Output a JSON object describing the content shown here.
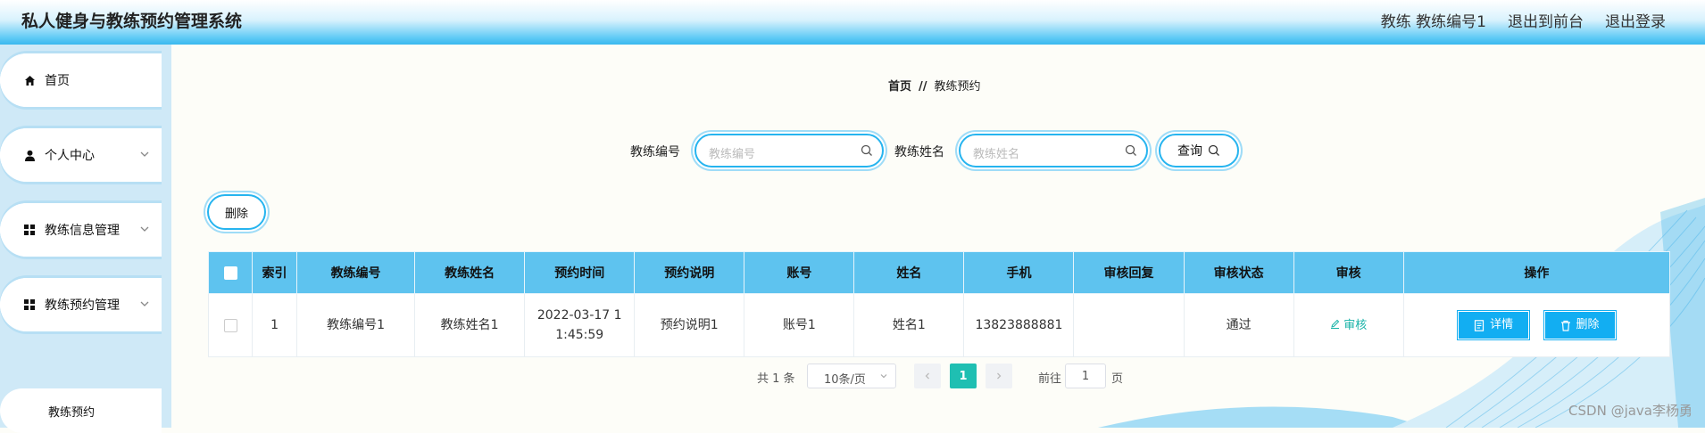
{
  "header": {
    "app_title": "私人健身与教练预约管理系统",
    "user_label": "教练 教练编号1",
    "to_front_label": "退出到前台",
    "logout_label": "退出登录"
  },
  "sidebar": {
    "items": [
      {
        "label": "首页",
        "icon": "home-icon"
      },
      {
        "label": "个人中心",
        "icon": "user-icon"
      },
      {
        "label": "教练信息管理",
        "icon": "grid-icon"
      },
      {
        "label": "教练预约管理",
        "icon": "grid-icon"
      }
    ],
    "sub_item": "教练预约"
  },
  "breadcrumb": {
    "home": "首页",
    "separator": "//",
    "current": "教练预约"
  },
  "search": {
    "field1_label": "教练编号",
    "field1_placeholder": "教练编号",
    "field2_label": "教练姓名",
    "field2_placeholder": "教练姓名",
    "query_label": "查询"
  },
  "toolbar": {
    "delete_label": "删除"
  },
  "table": {
    "headers": [
      "索引",
      "教练编号",
      "教练姓名",
      "预约时间",
      "预约说明",
      "账号",
      "姓名",
      "手机",
      "审核回复",
      "审核状态",
      "审核",
      "操作"
    ],
    "rows": [
      {
        "index": "1",
        "coach_no": "教练编号1",
        "coach_name": "教练姓名1",
        "time": "2022-03-17 11:45:59",
        "note": "预约说明1",
        "account": "账号1",
        "name": "姓名1",
        "phone": "13823888881",
        "reply": "",
        "status": "通过",
        "audit_label": "审核",
        "detail_label": "详情",
        "delete_label": "删除"
      }
    ]
  },
  "pagination": {
    "total": "共 1 条",
    "page_size": "10条/页",
    "current_page": "1",
    "goto_label": "前往",
    "goto_value": "1",
    "page_suffix": "页"
  },
  "watermark": "CSDN @java李杨勇",
  "colors": {
    "accent": "#12aef2",
    "header_row": "#5ec3ef",
    "page_active": "#1fbfb2",
    "sidebar_bg": "#cfe9f7"
  }
}
